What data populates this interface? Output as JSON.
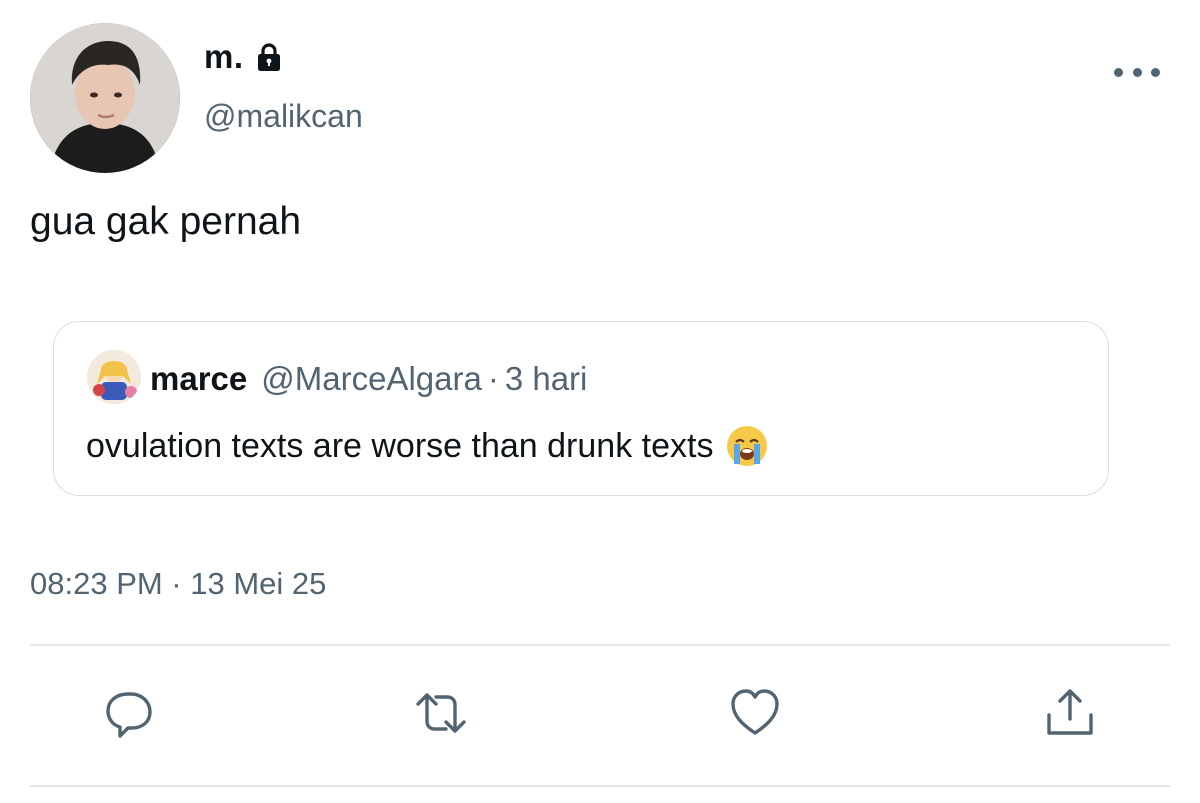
{
  "author": {
    "display_name": "m.",
    "handle": "@malikcan",
    "lock_icon": "lock-icon"
  },
  "tweet": {
    "text": "gua gak pernah",
    "timestamp": "08:23 PM · 13 Mei 25"
  },
  "quote": {
    "name": "marce",
    "handle": "@MarceAlgara",
    "separator": "·",
    "time": "3 hari",
    "text": "ovulation texts are worse than drunk texts",
    "emoji": "loudly-crying-face"
  },
  "actions": [
    "reply-icon",
    "retweet-icon",
    "like-icon",
    "share-icon"
  ],
  "colors": {
    "text": "#0f1419",
    "secondary": "#536471",
    "border": "#d9dee2"
  }
}
